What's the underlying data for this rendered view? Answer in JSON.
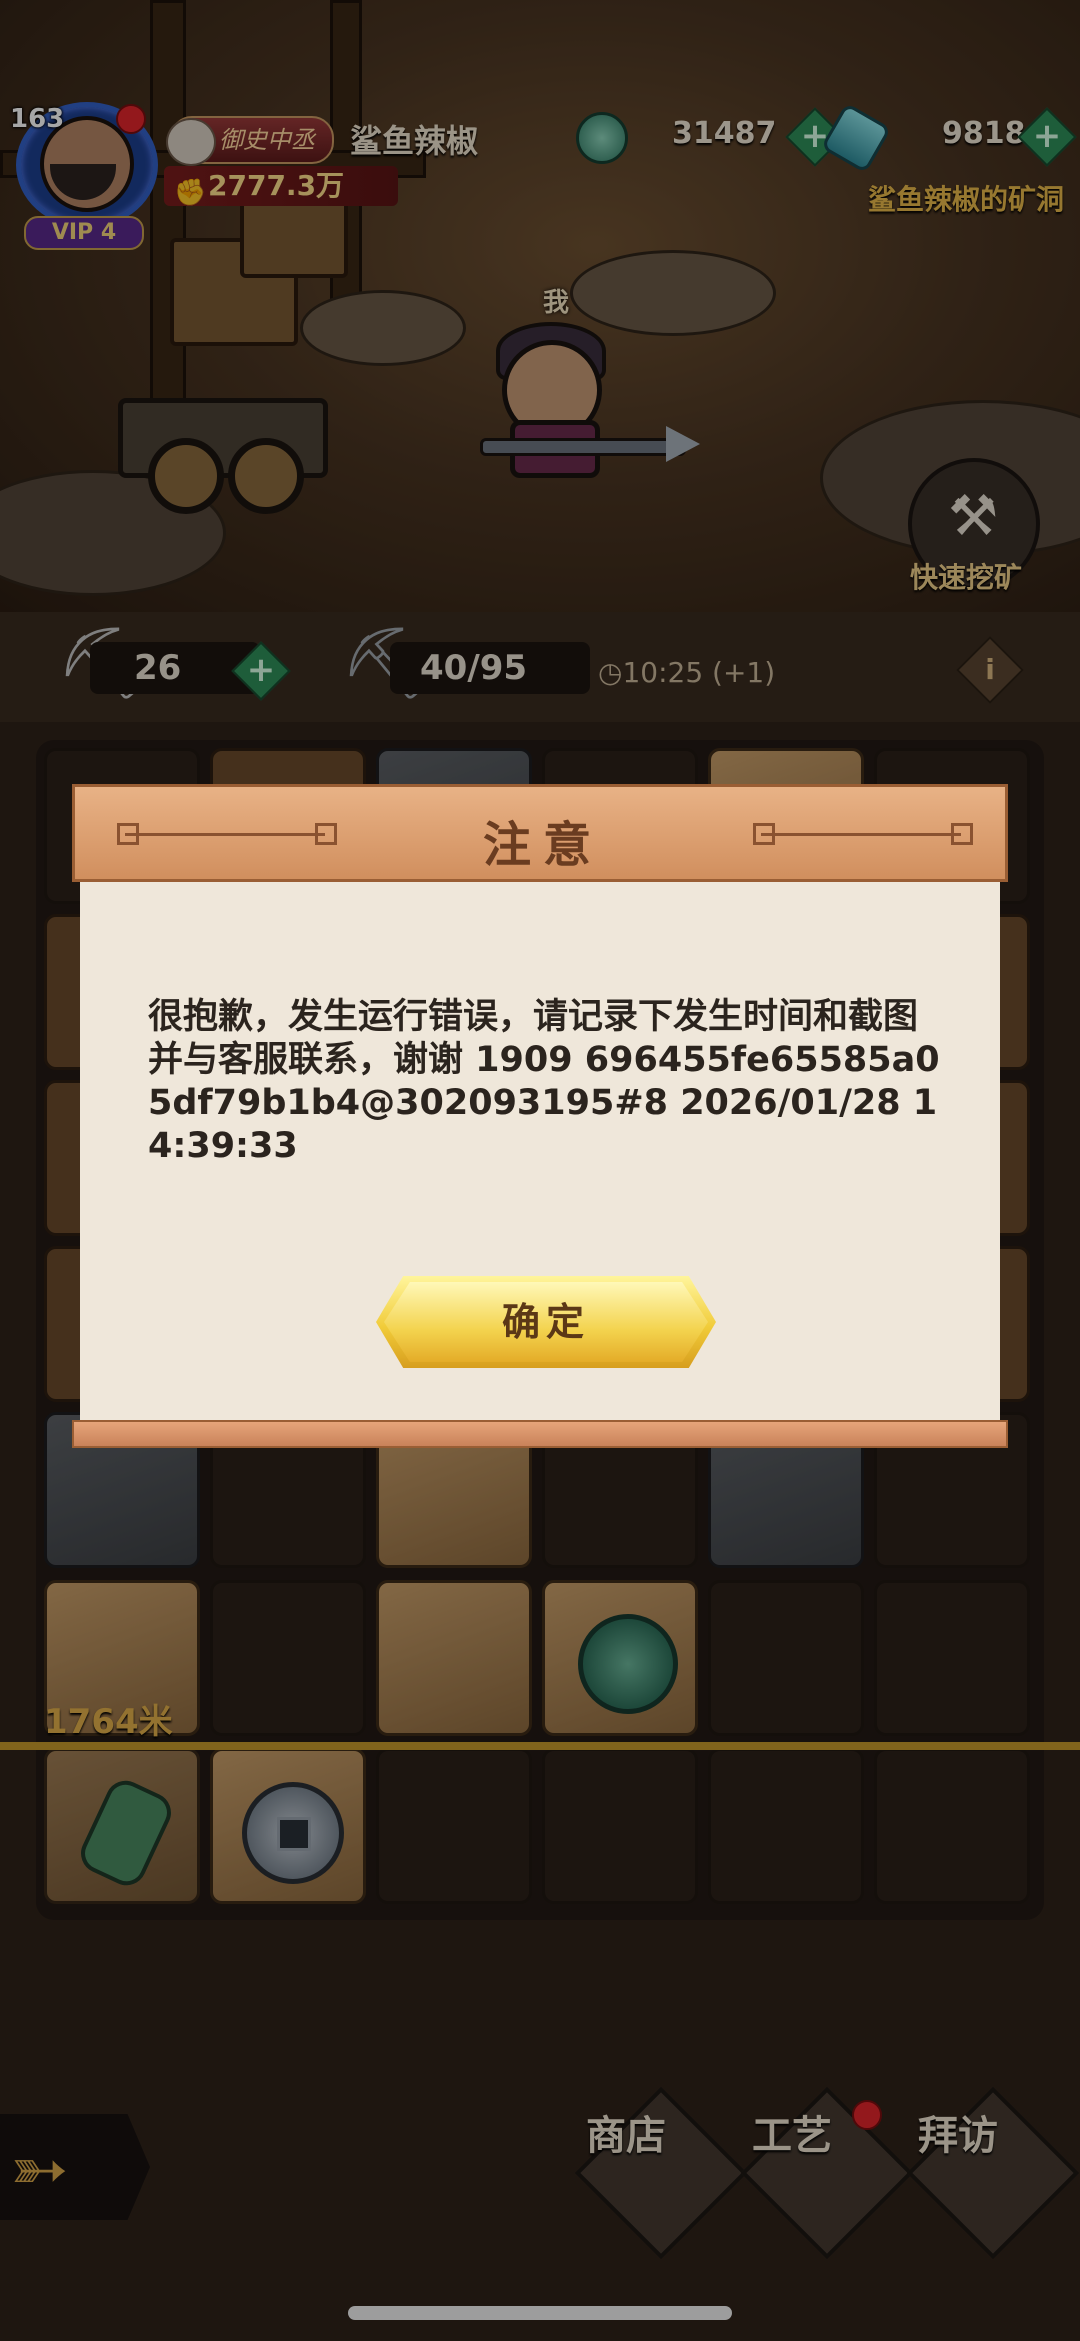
{
  "hud": {
    "level": "163",
    "vip": "VIP 4",
    "title_badge": "御史中丞",
    "player_name": "鲨鱼辣椒",
    "power": "2777.3万",
    "jade_amount": "31487",
    "gem_amount": "9818",
    "plus": "+",
    "mine_owner": "鲨鱼辣椒的矿洞",
    "me_label": "我",
    "quick_mine": "快速挖矿"
  },
  "pickbar": {
    "picks_small": "26",
    "picks_energy": "40/95",
    "timer": "10:25 (+1)",
    "info": "i"
  },
  "grid": {
    "depth_label": "1764米"
  },
  "bottom_nav": {
    "shop": "商店",
    "craft": "工艺",
    "visit": "拜访"
  },
  "dialog": {
    "title": "注意",
    "message": "很抱歉，发生运行错误，请记录下发生时间和截图并与客服联系，谢谢 1909 696455fe65585a05df79b1b4@302093195#8 2026/01/28 14:39:33",
    "confirm": "确定"
  },
  "colors": {
    "accent_gold": "#e2b04a",
    "dialog_header": "#d18f5e",
    "dialog_body": "#efe7da",
    "button_yellow": "#f1cc3a"
  },
  "icons": {
    "jade": "jade-coin-icon",
    "gem": "crystal-gem-icon",
    "pickaxe": "pickaxe-icon",
    "clock": "clock-icon",
    "shovel": "shovel-icon",
    "back": "back-arrow-icon"
  }
}
